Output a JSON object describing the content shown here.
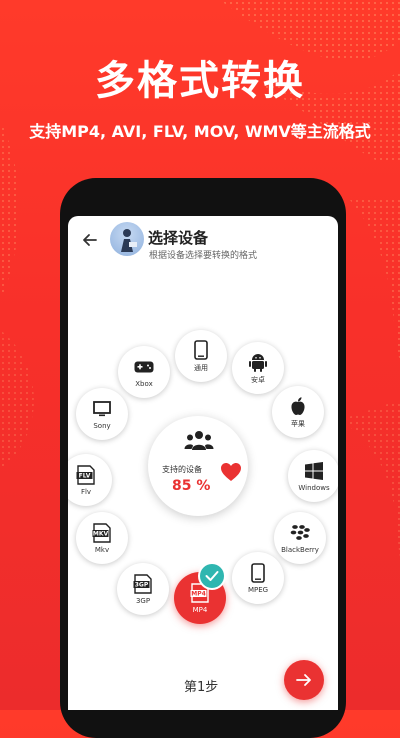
{
  "promo": {
    "headline": "多格式转换",
    "subline": "支持MP4, AVI, FLV, MOV, WMV等主流格式"
  },
  "app": {
    "header": {
      "title": "选择设备",
      "subtitle": "根据设备选择要转换的格式"
    },
    "devices": [
      {
        "key": "tongyong",
        "label": "通用",
        "icon": "phone-icon"
      },
      {
        "key": "android",
        "label": "安卓",
        "icon": "android-icon"
      },
      {
        "key": "apple",
        "label": "苹果",
        "icon": "apple-icon"
      },
      {
        "key": "windows",
        "label": "Windows",
        "icon": "windows-icon"
      },
      {
        "key": "blackberry",
        "label": "BlackBerry",
        "icon": "blackberry-icon"
      },
      {
        "key": "mpeg",
        "label": "MPEG",
        "icon": "phone-icon"
      },
      {
        "key": "mp4",
        "label": "MP4",
        "icon": "mp4-file-icon",
        "selected": true
      },
      {
        "key": "3gp",
        "label": "3GP",
        "icon": "3gp-file-icon"
      },
      {
        "key": "mkv",
        "label": "Mkv",
        "icon": "mkv-file-icon"
      },
      {
        "key": "flv",
        "label": "Flv",
        "icon": "flv-file-icon"
      },
      {
        "key": "sony",
        "label": "Sony",
        "icon": "tv-icon"
      },
      {
        "key": "xbox",
        "label": "Xbox",
        "icon": "gamepad-icon"
      }
    ],
    "center": {
      "label": "支持的设备",
      "percent": "85 %"
    },
    "footer": {
      "step": "第1步"
    },
    "colors": {
      "accent": "#ea3232",
      "check": "#2fb6b0"
    }
  }
}
